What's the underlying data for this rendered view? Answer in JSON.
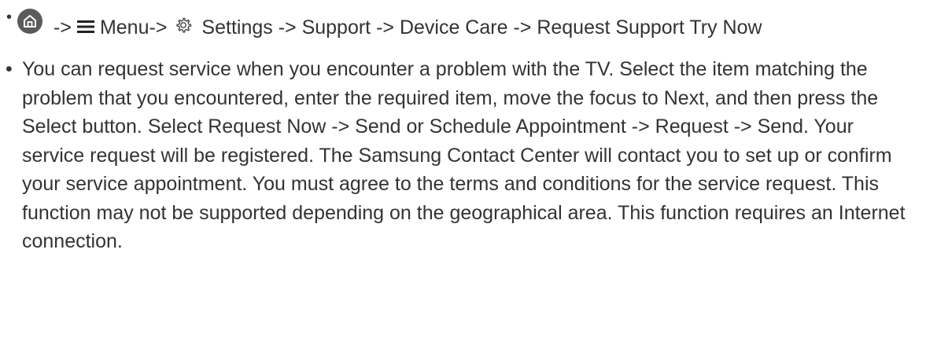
{
  "item1": {
    "bullet": "•",
    "arrow1": "->",
    "menu_label": "Menu->",
    "settings_path": "Settings -> Support -> Device Care -> Request Support Try Now",
    "icons": [
      "home-icon",
      "menu-icon",
      "gear-icon"
    ]
  },
  "item2": {
    "bullet": "•",
    "text": "You can request service when you encounter a problem with the TV. Select the item matching the problem that you encountered, enter the required item, move the focus to Next, and then press the Select button. Select Request Now -> Send or Schedule Appointment -> Request -> Send. Your service request will be registered. The Samsung Contact Center will contact you to set up or confirm your service appointment. You must agree to the terms and conditions for the service request. This function may not be supported depending on the geographical area. This function requires an Internet connection."
  },
  "colors": {
    "text": "#333333",
    "icon": "#5b5b5b"
  }
}
